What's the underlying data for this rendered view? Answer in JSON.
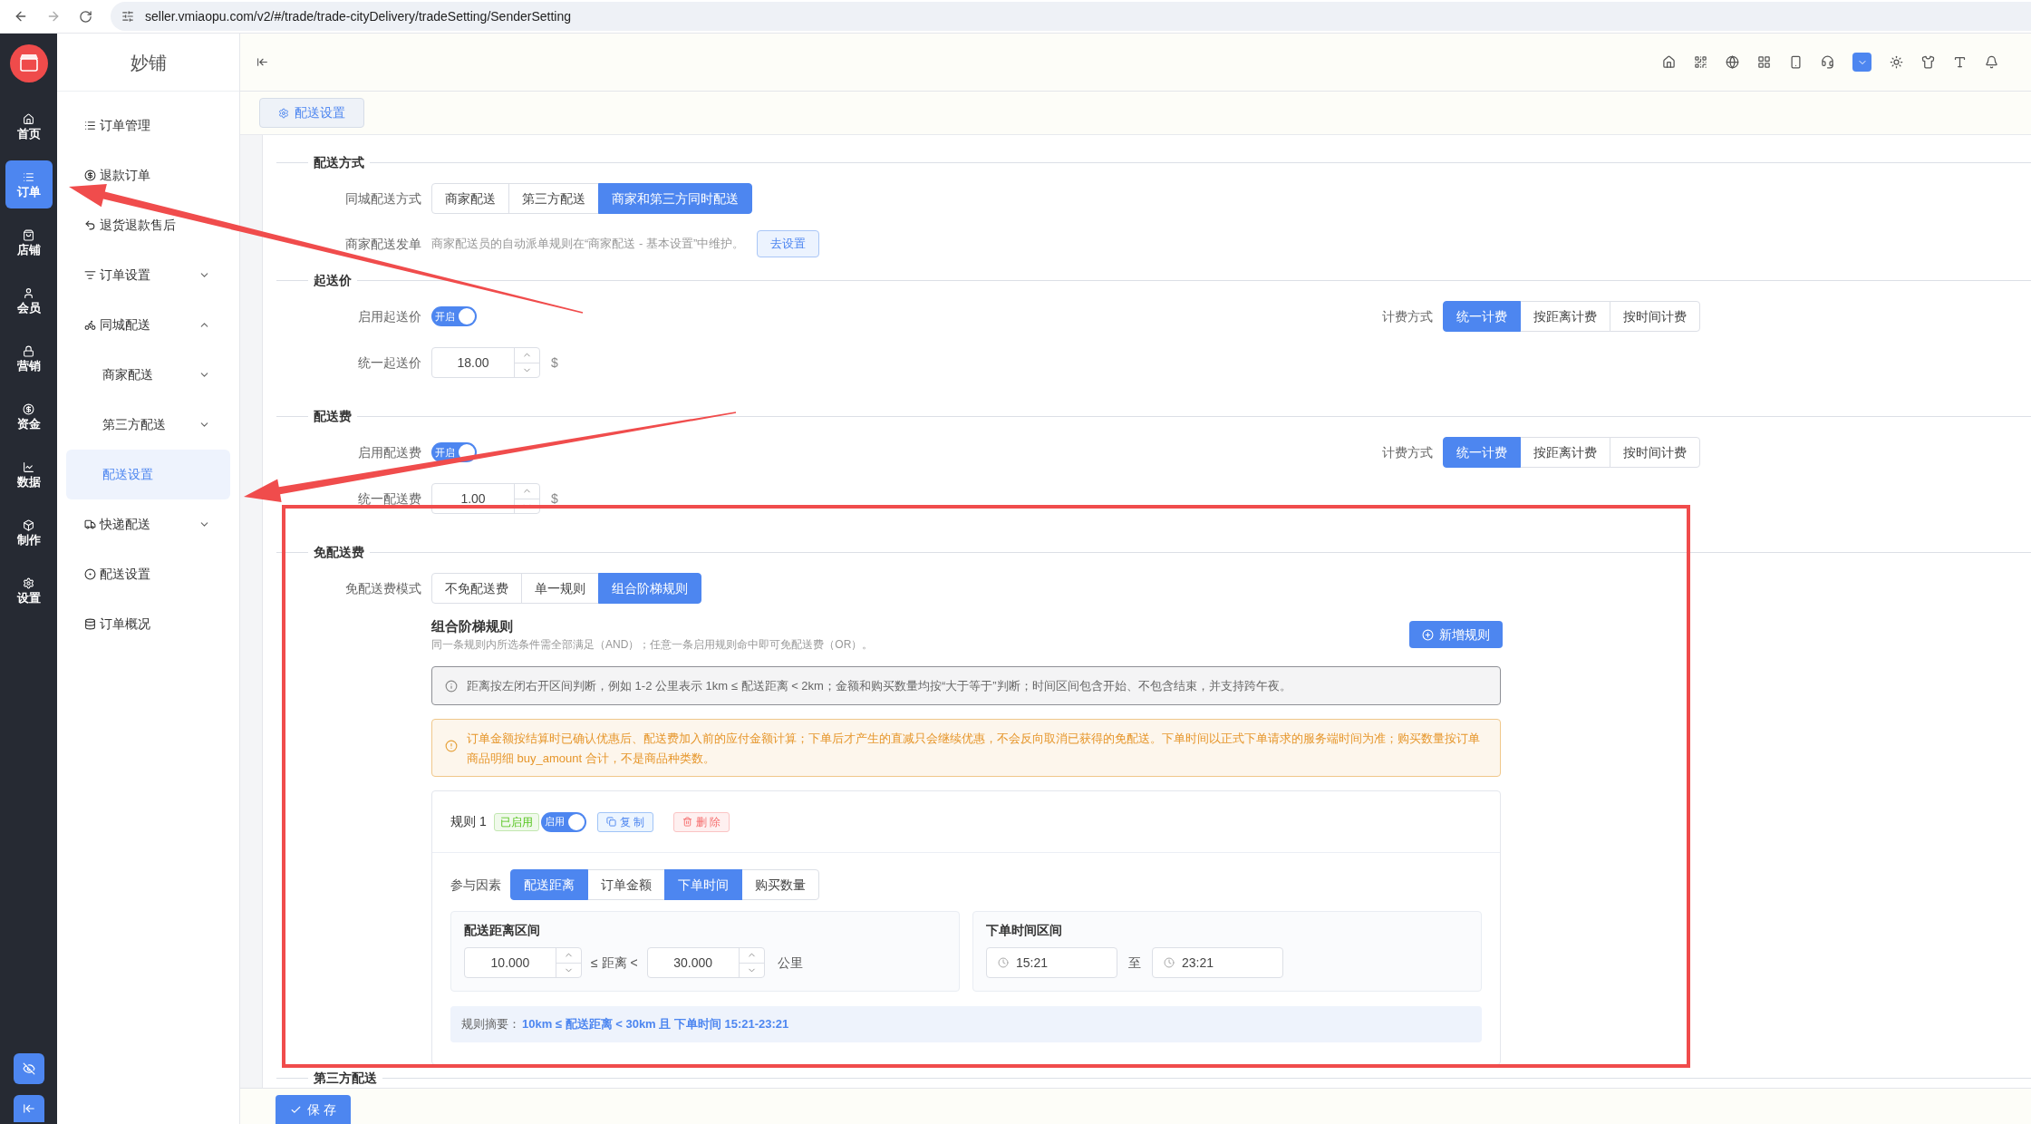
{
  "browser": {
    "url": "seller.vmiaopu.com/v2/#/trade/trade-cityDelivery/tradeSetting/SenderSetting"
  },
  "rail": {
    "items": [
      {
        "label": "首页",
        "selected": false
      },
      {
        "label": "订单",
        "selected": true
      },
      {
        "label": "店铺",
        "selected": false
      },
      {
        "label": "会员",
        "selected": false
      },
      {
        "label": "营销",
        "selected": false
      },
      {
        "label": "资金",
        "selected": false
      },
      {
        "label": "数据",
        "selected": false
      },
      {
        "label": "制作",
        "selected": false
      },
      {
        "label": "设置",
        "selected": false
      }
    ]
  },
  "sidebar": {
    "title": "妙铺",
    "items": [
      {
        "label": "订单管理",
        "selected": false
      },
      {
        "label": "退款订单",
        "selected": false
      },
      {
        "label": "退货退款售后",
        "selected": false
      },
      {
        "label": "订单设置",
        "selected": false,
        "expanded": false
      },
      {
        "label": "同城配送",
        "selected": false,
        "expanded": true,
        "children": [
          {
            "label": "商家配送",
            "selected": false,
            "expanded": false
          },
          {
            "label": "第三方配送",
            "selected": false,
            "expanded": false
          },
          {
            "label": "配送设置",
            "selected": true
          }
        ]
      },
      {
        "label": "快递配送",
        "selected": false,
        "expanded": false
      },
      {
        "label": "配送设置",
        "selected": false
      },
      {
        "label": "订单概况",
        "selected": false
      }
    ]
  },
  "tabs": [
    {
      "label": "配送设置",
      "selected": true
    }
  ],
  "delivery_method": {
    "title": "配送方式",
    "mode": {
      "label": "同城配送方式",
      "options": [
        {
          "label": "商家配送",
          "selected": false
        },
        {
          "label": "第三方配送",
          "selected": false
        },
        {
          "label": "商家和第三方同时配送",
          "selected": true
        }
      ]
    },
    "dispatch": {
      "label": "商家配送发单",
      "note": "商家配送员的自动派单规则在“商家配送 - 基本设置”中维护。",
      "button": "去设置"
    }
  },
  "min_price": {
    "title": "起送价",
    "enable": {
      "label": "启用起送价",
      "on": true,
      "on_text": "开启"
    },
    "billing": {
      "label": "计费方式",
      "options": [
        {
          "label": "统一计费",
          "selected": true
        },
        {
          "label": "按距离计费",
          "selected": false
        },
        {
          "label": "按时间计费",
          "selected": false
        }
      ]
    },
    "price": {
      "label": "统一起送价",
      "value": "18.00",
      "unit": "$"
    }
  },
  "fee": {
    "title": "配送费",
    "enable": {
      "label": "启用配送费",
      "on": true,
      "on_text": "开启"
    },
    "billing": {
      "label": "计费方式",
      "options": [
        {
          "label": "统一计费",
          "selected": true
        },
        {
          "label": "按距离计费",
          "selected": false
        },
        {
          "label": "按时间计费",
          "selected": false
        }
      ]
    },
    "price": {
      "label": "统一配送费",
      "value": "1.00",
      "unit": "$"
    }
  },
  "free_fee": {
    "title": "免配送费",
    "mode": {
      "label": "免配送费模式",
      "options": [
        {
          "label": "不免配送费",
          "selected": false
        },
        {
          "label": "单一规则",
          "selected": false
        },
        {
          "label": "组合阶梯规则",
          "selected": true
        }
      ]
    },
    "rules_title": "组合阶梯规则",
    "rules_subtitle": "同一条规则内所选条件需全部满足（AND）；任意一条启用规则命中即可免配送费（OR）。",
    "add_button": "新增规则",
    "info": "距离按左闭右开区间判断，例如 1-2 公里表示 1km ≤ 配送距离 < 2km；金额和购买数量均按“大于等于”判断；时间区间包含开始、不包含结束，并支持跨午夜。",
    "warning": "订单金额按结算时已确认优惠后、配送费加入前的应付金额计算；下单后才产生的直减只会继续优惠，不会反向取消已获得的免配送。下单时间以正式下单请求的服务端时间为准；购买数量按订单商品明细 buy_amount 合计，不是商品种类数。",
    "rules": [
      {
        "title": "规则 1",
        "status": "已启用",
        "enable": {
          "on": true,
          "on_text": "启用"
        },
        "copy_button": "复 制",
        "delete_button": "删 除",
        "factors": {
          "label": "参与因素",
          "options": [
            {
              "label": "配送距离",
              "selected": true
            },
            {
              "label": "订单金额",
              "selected": false
            },
            {
              "label": "下单时间",
              "selected": true
            },
            {
              "label": "购买数量",
              "selected": false
            }
          ]
        },
        "distance": {
          "title": "配送距离区间",
          "min": "10.000",
          "op": "≤ 距离 <",
          "max": "30.000",
          "unit": "公里"
        },
        "time": {
          "title": "下单时间区间",
          "start": "15:21",
          "sep": "至",
          "end": "23:21"
        },
        "summary": {
          "label": "规则摘要：",
          "text": "10km ≤ 配送距离 < 30km 且 下单时间 15:21-23:21"
        }
      }
    ]
  },
  "next_section": {
    "title": "第三方配送"
  },
  "save_button": "保 存"
}
